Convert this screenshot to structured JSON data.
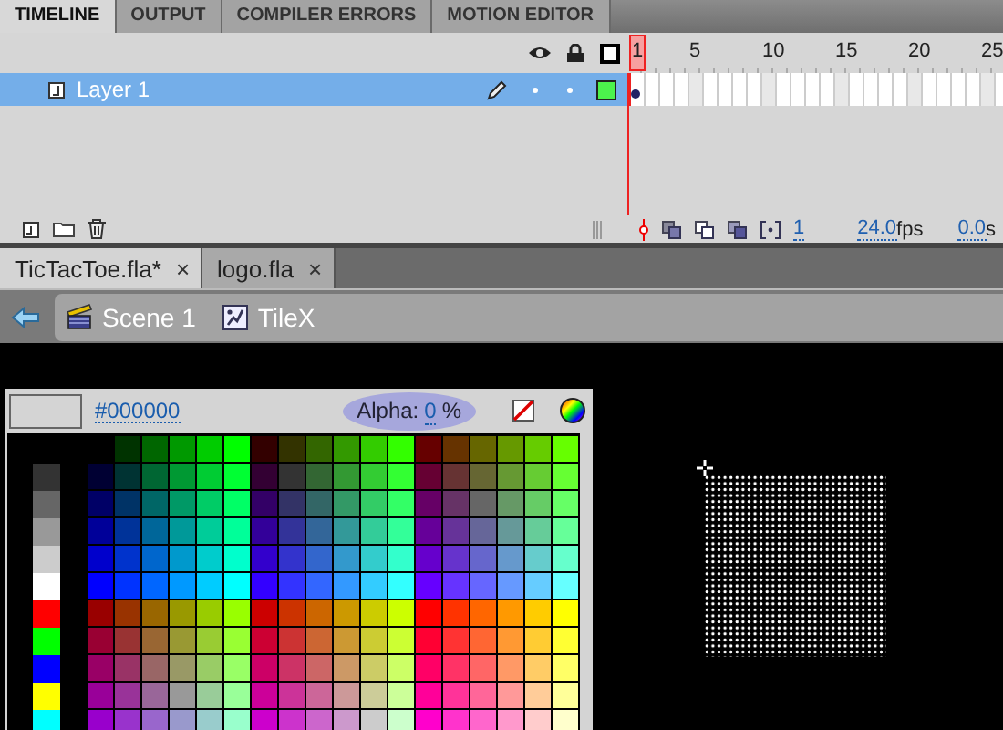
{
  "panel_tabs": [
    {
      "label": "TIMELINE",
      "selected": true
    },
    {
      "label": "OUTPUT",
      "selected": false
    },
    {
      "label": "COMPILER ERRORS",
      "selected": false
    },
    {
      "label": "MOTION EDITOR",
      "selected": false
    }
  ],
  "timeline": {
    "ruler": [
      "1",
      "5",
      "10",
      "15",
      "20",
      "25"
    ],
    "layers": [
      {
        "name": "Layer 1",
        "selected": true
      }
    ],
    "status": {
      "current_frame": "1",
      "frame_rate": "24.0",
      "frame_rate_unit": "fps",
      "elapsed": "0.0",
      "elapsed_unit": "s"
    }
  },
  "document_tabs": [
    {
      "label": "TicTacToe.fla*",
      "selected": true,
      "close": "×"
    },
    {
      "label": "logo.fla",
      "selected": false,
      "close": "×"
    }
  ],
  "breadcrumb": [
    {
      "kind": "scene",
      "label": "Scene 1"
    },
    {
      "kind": "symbol",
      "label": "TileX"
    }
  ],
  "swatches": {
    "hex": "#000000",
    "alpha_label": "Alpha:",
    "alpha_value": "0",
    "alpha_unit": "%"
  }
}
